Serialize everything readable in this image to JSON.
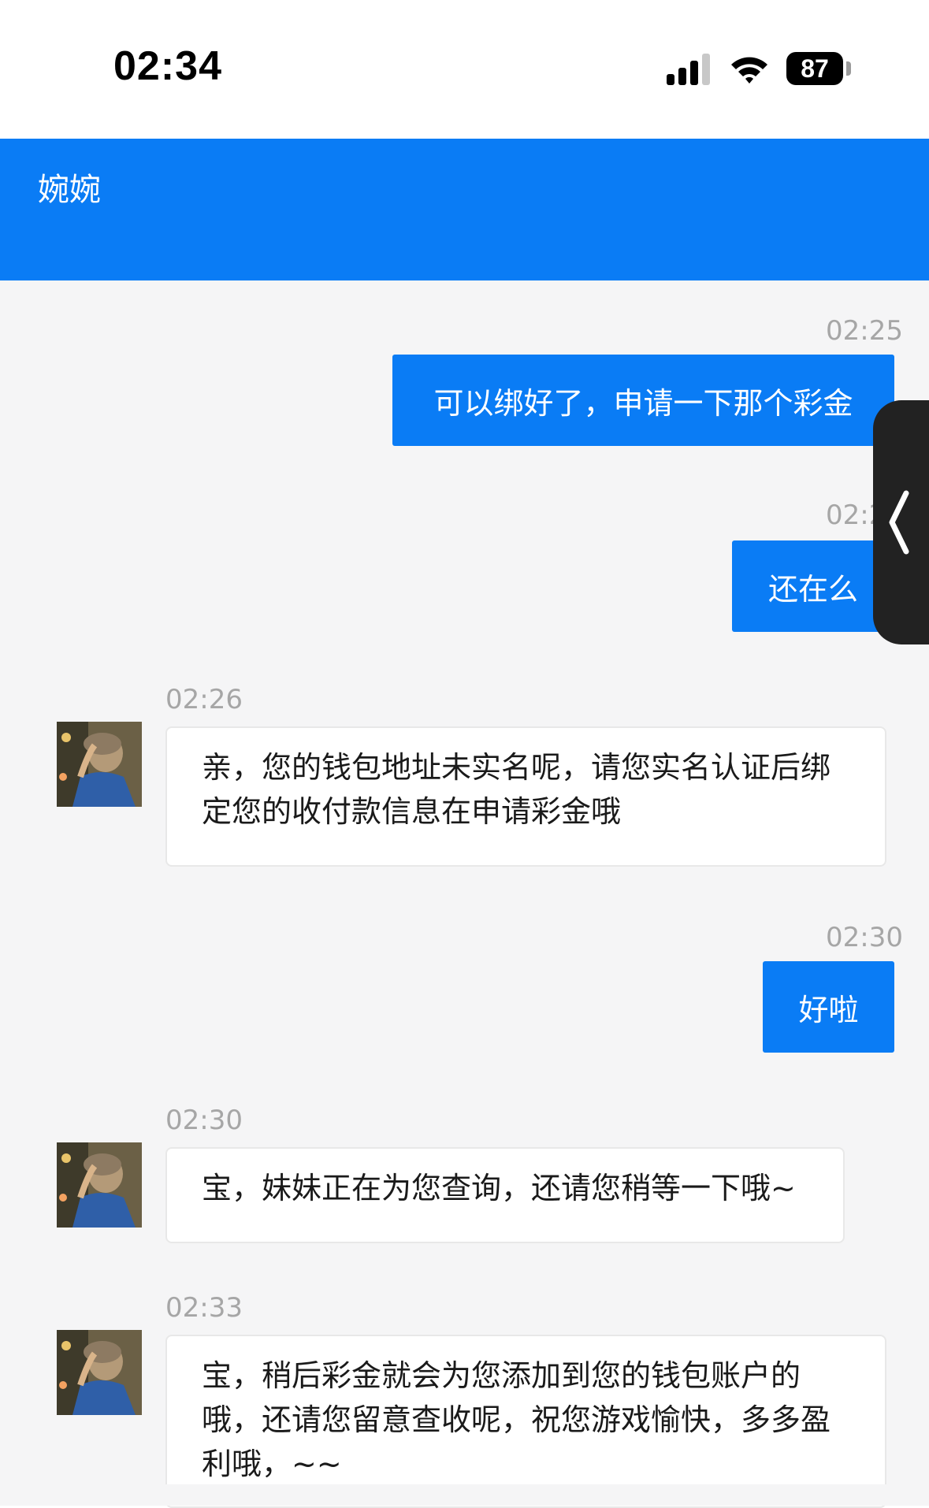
{
  "status_bar": {
    "time": "02:34",
    "battery": "87"
  },
  "header": {
    "title": "婉婉"
  },
  "messages": [
    {
      "time": "02:25",
      "text": "可以绑好了，申请一下那个彩金"
    },
    {
      "time": "02:2",
      "text": "还在么"
    },
    {
      "time": "02:26",
      "text": "亲，您的钱包地址未实名呢，请您实名认证后绑定您的收付款信息在申请彩金哦"
    },
    {
      "time": "02:30",
      "text": "好啦"
    },
    {
      "time": "02:30",
      "text": "宝，妹妹正在为您查询，还请您稍等一下哦~"
    },
    {
      "time": "02:33",
      "text": "宝，稍后彩金就会为您添加到您的钱包账户的哦，还请您留意查收呢，祝您游戏愉快，多多盈利哦，~~"
    }
  ],
  "colors": {
    "accent": "#0a7cf5",
    "chat_background": "#f5f5f6",
    "timestamp": "#a6a6a6"
  },
  "icons": {
    "signal": "cellular-signal-icon",
    "wifi": "wifi-icon",
    "battery": "battery-icon",
    "handle": "chevron-left-icon"
  }
}
